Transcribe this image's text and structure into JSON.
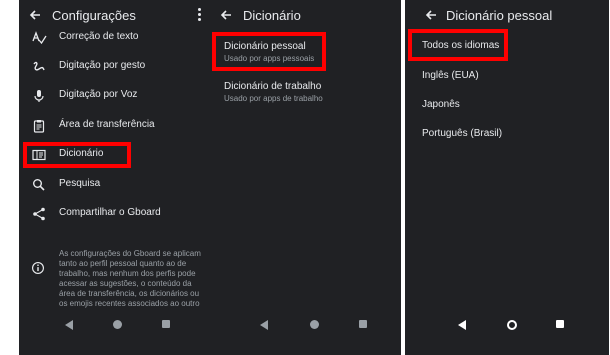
{
  "screen1": {
    "title": "Configurações",
    "items": [
      {
        "label": "Correção de texto",
        "icon": "spellcheck-icon"
      },
      {
        "label": "Digitação por gesto",
        "icon": "gesture-icon"
      },
      {
        "label": "Digitação por Voz",
        "icon": "microphone-icon"
      },
      {
        "label": "Área de transferência",
        "icon": "clipboard-icon"
      },
      {
        "label": "Dicionário",
        "icon": "dictionary-icon"
      },
      {
        "label": "Pesquisa",
        "icon": "search-icon"
      },
      {
        "label": "Compartilhar o Gboard",
        "icon": "share-icon"
      }
    ],
    "info_text": "As configurações do Gboard se aplicam tanto ao perfil pessoal quanto ao de trabalho, mas nenhum dos perfis pode acessar as sugestões, o conteúdo da área de transferência, os dicionários ou os emojis recentes associados ao outro"
  },
  "screen2": {
    "title": "Dicionário",
    "items": [
      {
        "title": "Dicionário pessoal",
        "subtitle": "Usado por apps pessoais"
      },
      {
        "title": "Dicionário de trabalho",
        "subtitle": "Usado por apps de trabalho"
      }
    ]
  },
  "screen3": {
    "title": "Dicionário pessoal",
    "items": [
      "Todos os idiomas",
      "Inglês (EUA)",
      "Japonês",
      "Português (Brasil)"
    ]
  },
  "colors": {
    "background": "#202124",
    "text": "#e8eaed",
    "secondary_text": "#9aa0a6",
    "highlight": "#ff0000"
  }
}
